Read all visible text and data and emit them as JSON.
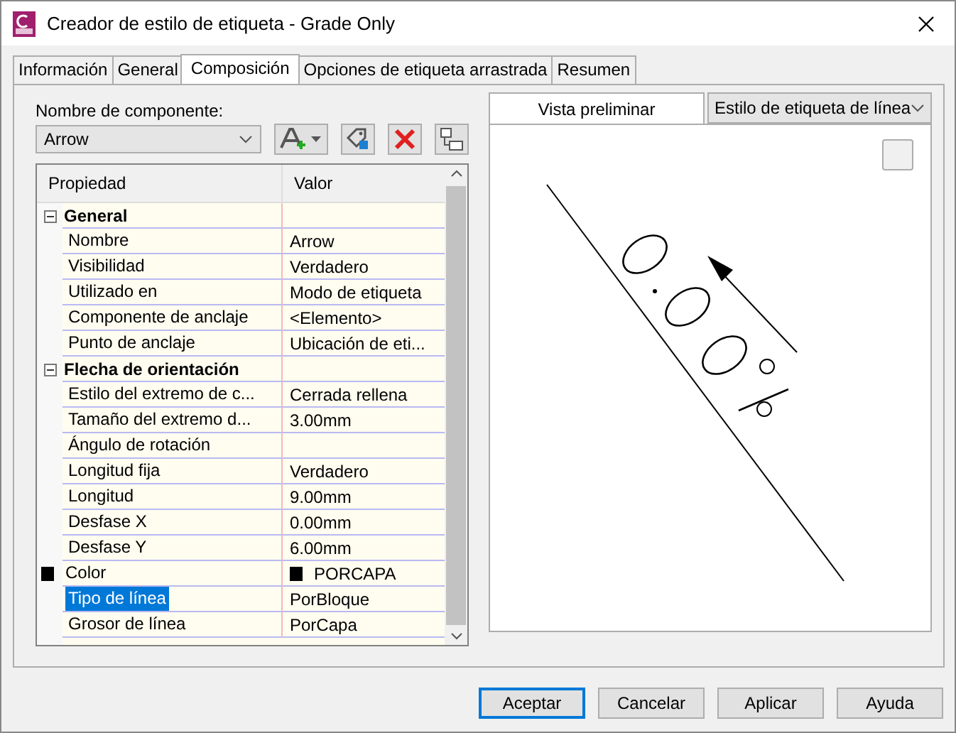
{
  "window": {
    "title": "Creador de estilo de etiqueta - Grade Only"
  },
  "tabs": [
    {
      "label": "Información",
      "selected": false
    },
    {
      "label": "General",
      "selected": false
    },
    {
      "label": "Composición",
      "selected": true
    },
    {
      "label": "Opciones de etiqueta arrastrada",
      "selected": false
    },
    {
      "label": "Resumen",
      "selected": false
    }
  ],
  "component": {
    "label": "Nombre de componente:",
    "value": "Arrow"
  },
  "grid": {
    "columns": [
      "Propiedad",
      "Valor"
    ],
    "groups": [
      {
        "name": "General",
        "expanded": true,
        "rows": [
          {
            "property": "Nombre",
            "value": "Arrow",
            "selected": false
          },
          {
            "property": "Visibilidad",
            "value": "Verdadero",
            "selected": false
          },
          {
            "property": "Utilizado en",
            "value": "Modo de etiqueta",
            "selected": false
          },
          {
            "property": "Componente de anclaje",
            "value": "<Elemento>",
            "selected": false
          },
          {
            "property": "Punto de anclaje",
            "value": "Ubicación de eti...",
            "selected": false
          }
        ]
      },
      {
        "name": "Flecha de orientación",
        "expanded": true,
        "rows": [
          {
            "property": "Estilo del extremo de c...",
            "value": "Cerrada rellena",
            "selected": false
          },
          {
            "property": "Tamaño del extremo d...",
            "value": "3.00mm",
            "selected": false
          },
          {
            "property": "Ángulo de rotación",
            "selected": false
          },
          {
            "property": "Longitud fija",
            "value": "Verdadero",
            "selected": false
          },
          {
            "property": "Longitud",
            "value": "9.00mm",
            "selected": false
          },
          {
            "property": "Desfase X",
            "value": "0.00mm",
            "selected": false
          },
          {
            "property": "Desfase Y",
            "value": "6.00mm",
            "selected": false
          },
          {
            "property": "Color",
            "value": "PORCAPA",
            "kind": "color",
            "color": "#000000",
            "selected": false
          },
          {
            "property": "Tipo de línea",
            "value": "PorBloque",
            "selected": true
          },
          {
            "property": "Grosor de línea",
            "value": "PorCapa",
            "selected": false
          }
        ]
      }
    ]
  },
  "preview": {
    "label": "Vista preliminar",
    "style": "Estilo de etiqueta de línea"
  },
  "buttons": [
    {
      "label": "Aceptar",
      "default": true
    },
    {
      "label": "Cancelar",
      "default": false
    },
    {
      "label": "Aplicar",
      "default": false
    },
    {
      "label": "Ayuda",
      "default": false
    }
  ]
}
